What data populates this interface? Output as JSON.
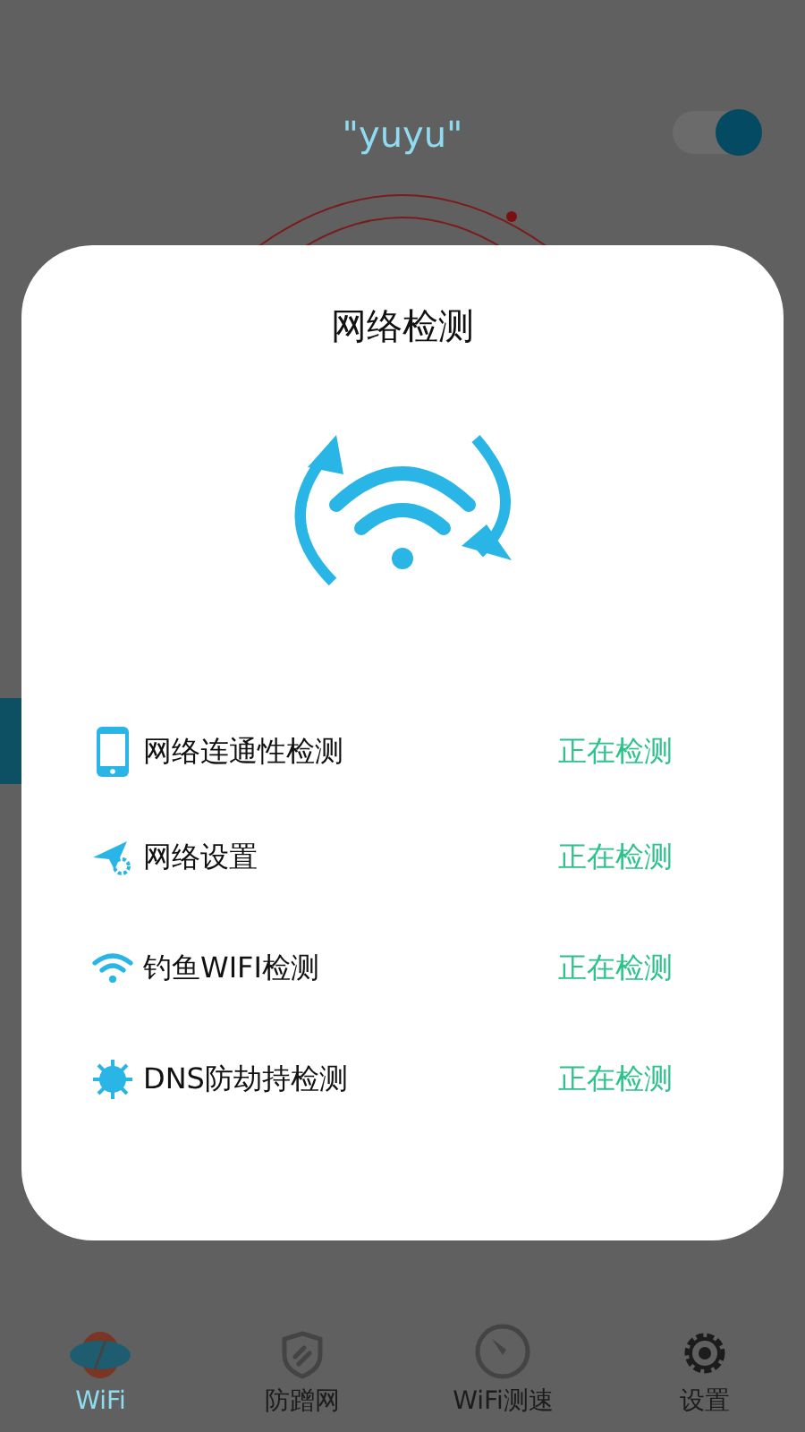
{
  "header": {
    "network_name": "\"yuyu\"",
    "toggle": {
      "on": true
    }
  },
  "dialog": {
    "title": "网络检测",
    "checks": [
      {
        "kind": "phone",
        "label": "网络连通性检测",
        "status": "正在检测"
      },
      {
        "kind": "plane",
        "label": "网络设置",
        "status": "正在检测"
      },
      {
        "kind": "wifi",
        "label": "钓鱼WIFI检测",
        "status": "正在检测"
      },
      {
        "kind": "virus",
        "label": "DNS防劫持检测",
        "status": "正在检测"
      }
    ]
  },
  "tabs": [
    {
      "kind": "wifi",
      "label": "WiFi",
      "selected": true
    },
    {
      "kind": "shield",
      "label": "防蹭网",
      "selected": false
    },
    {
      "kind": "speed",
      "label": "WiFi测速",
      "selected": false
    },
    {
      "kind": "gear",
      "label": "设置",
      "selected": false
    }
  ]
}
